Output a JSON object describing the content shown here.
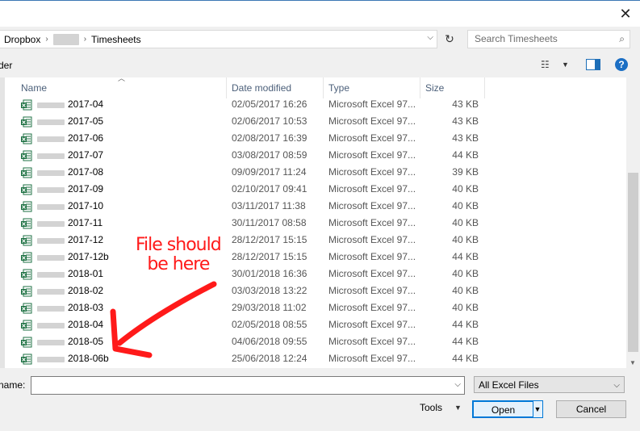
{
  "address": {
    "segments": [
      "Dropbox",
      "Timesheets"
    ],
    "search_placeholder": "Search Timesheets"
  },
  "cmdbar": {
    "label": "der"
  },
  "columns": {
    "name": "Name",
    "date": "Date modified",
    "type": "Type",
    "size": "Size"
  },
  "files": [
    {
      "name": "2017-04",
      "date": "02/05/2017 16:26",
      "type": "Microsoft Excel 97...",
      "size": "43 KB"
    },
    {
      "name": "2017-05",
      "date": "02/06/2017 10:53",
      "type": "Microsoft Excel 97...",
      "size": "43 KB"
    },
    {
      "name": "2017-06",
      "date": "02/08/2017 16:39",
      "type": "Microsoft Excel 97...",
      "size": "43 KB"
    },
    {
      "name": "2017-07",
      "date": "03/08/2017 08:59",
      "type": "Microsoft Excel 97...",
      "size": "44 KB"
    },
    {
      "name": "2017-08",
      "date": "09/09/2017 11:24",
      "type": "Microsoft Excel 97...",
      "size": "39 KB"
    },
    {
      "name": "2017-09",
      "date": "02/10/2017 09:41",
      "type": "Microsoft Excel 97...",
      "size": "40 KB"
    },
    {
      "name": "2017-10",
      "date": "03/11/2017 11:38",
      "type": "Microsoft Excel 97...",
      "size": "40 KB"
    },
    {
      "name": "2017-11",
      "date": "30/11/2017 08:58",
      "type": "Microsoft Excel 97...",
      "size": "40 KB"
    },
    {
      "name": "2017-12",
      "date": "28/12/2017 15:15",
      "type": "Microsoft Excel 97...",
      "size": "40 KB"
    },
    {
      "name": "2017-12b",
      "date": "28/12/2017 15:15",
      "type": "Microsoft Excel 97...",
      "size": "44 KB"
    },
    {
      "name": "2018-01",
      "date": "30/01/2018 16:36",
      "type": "Microsoft Excel 97...",
      "size": "40 KB"
    },
    {
      "name": "2018-02",
      "date": "03/03/2018 13:22",
      "type": "Microsoft Excel 97...",
      "size": "40 KB"
    },
    {
      "name": "2018-03",
      "date": "29/03/2018 11:02",
      "type": "Microsoft Excel 97...",
      "size": "40 KB"
    },
    {
      "name": "2018-04",
      "date": "02/05/2018 08:55",
      "type": "Microsoft Excel 97...",
      "size": "44 KB"
    },
    {
      "name": "2018-05",
      "date": "04/06/2018 09:55",
      "type": "Microsoft Excel 97...",
      "size": "44 KB"
    },
    {
      "name": "2018-06b",
      "date": "25/06/2018 12:24",
      "type": "Microsoft Excel 97...",
      "size": "44 KB"
    }
  ],
  "annotation": {
    "line1": "File should",
    "line2": "be here",
    "color": "#ff1a1a"
  },
  "bottom": {
    "filename_label": "name:",
    "filename_value": "",
    "filter": "All Excel Files",
    "tools": "Tools",
    "open": "Open",
    "cancel": "Cancel"
  },
  "colors": {
    "accent": "#0078d7",
    "header_text": "#4c607a",
    "excel_green": "#1f7244"
  }
}
